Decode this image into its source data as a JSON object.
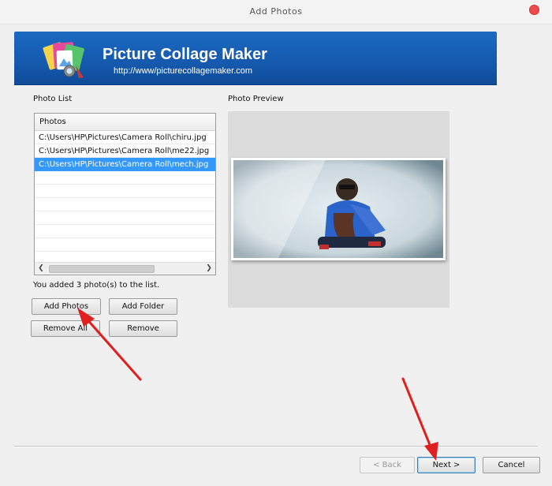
{
  "window": {
    "title": "Add Photos"
  },
  "banner": {
    "title": "Picture Collage Maker",
    "url": "http://www/picturecollagemaker.com"
  },
  "photo_list": {
    "label": "Photo List",
    "column_header": "Photos",
    "items": [
      "C:\\Users\\HP\\Pictures\\Camera Roll\\chiru.jpg",
      "C:\\Users\\HP\\Pictures\\Camera Roll\\me22.jpg",
      "C:\\Users\\HP\\Pictures\\Camera Roll\\mech.jpg"
    ],
    "selected_index": 2,
    "status": "You added 3 photo(s) to the list."
  },
  "preview": {
    "label": "Photo Preview"
  },
  "buttons": {
    "add_photos": "Add Photos",
    "add_folder": "Add Folder",
    "remove_all": "Remove All",
    "remove": "Remove",
    "back": "< Back",
    "next": "Next >",
    "cancel": "Cancel"
  },
  "colors": {
    "banner": "#1559ad",
    "selection": "#3399ff",
    "annotation_arrow": "#e02020",
    "close_button": "#ec4b4b"
  },
  "icons": {
    "logo": "picture-collage-logo-icon",
    "scroll_left": "scroll-left-arrow-icon",
    "scroll_right": "scroll-right-arrow-icon"
  }
}
